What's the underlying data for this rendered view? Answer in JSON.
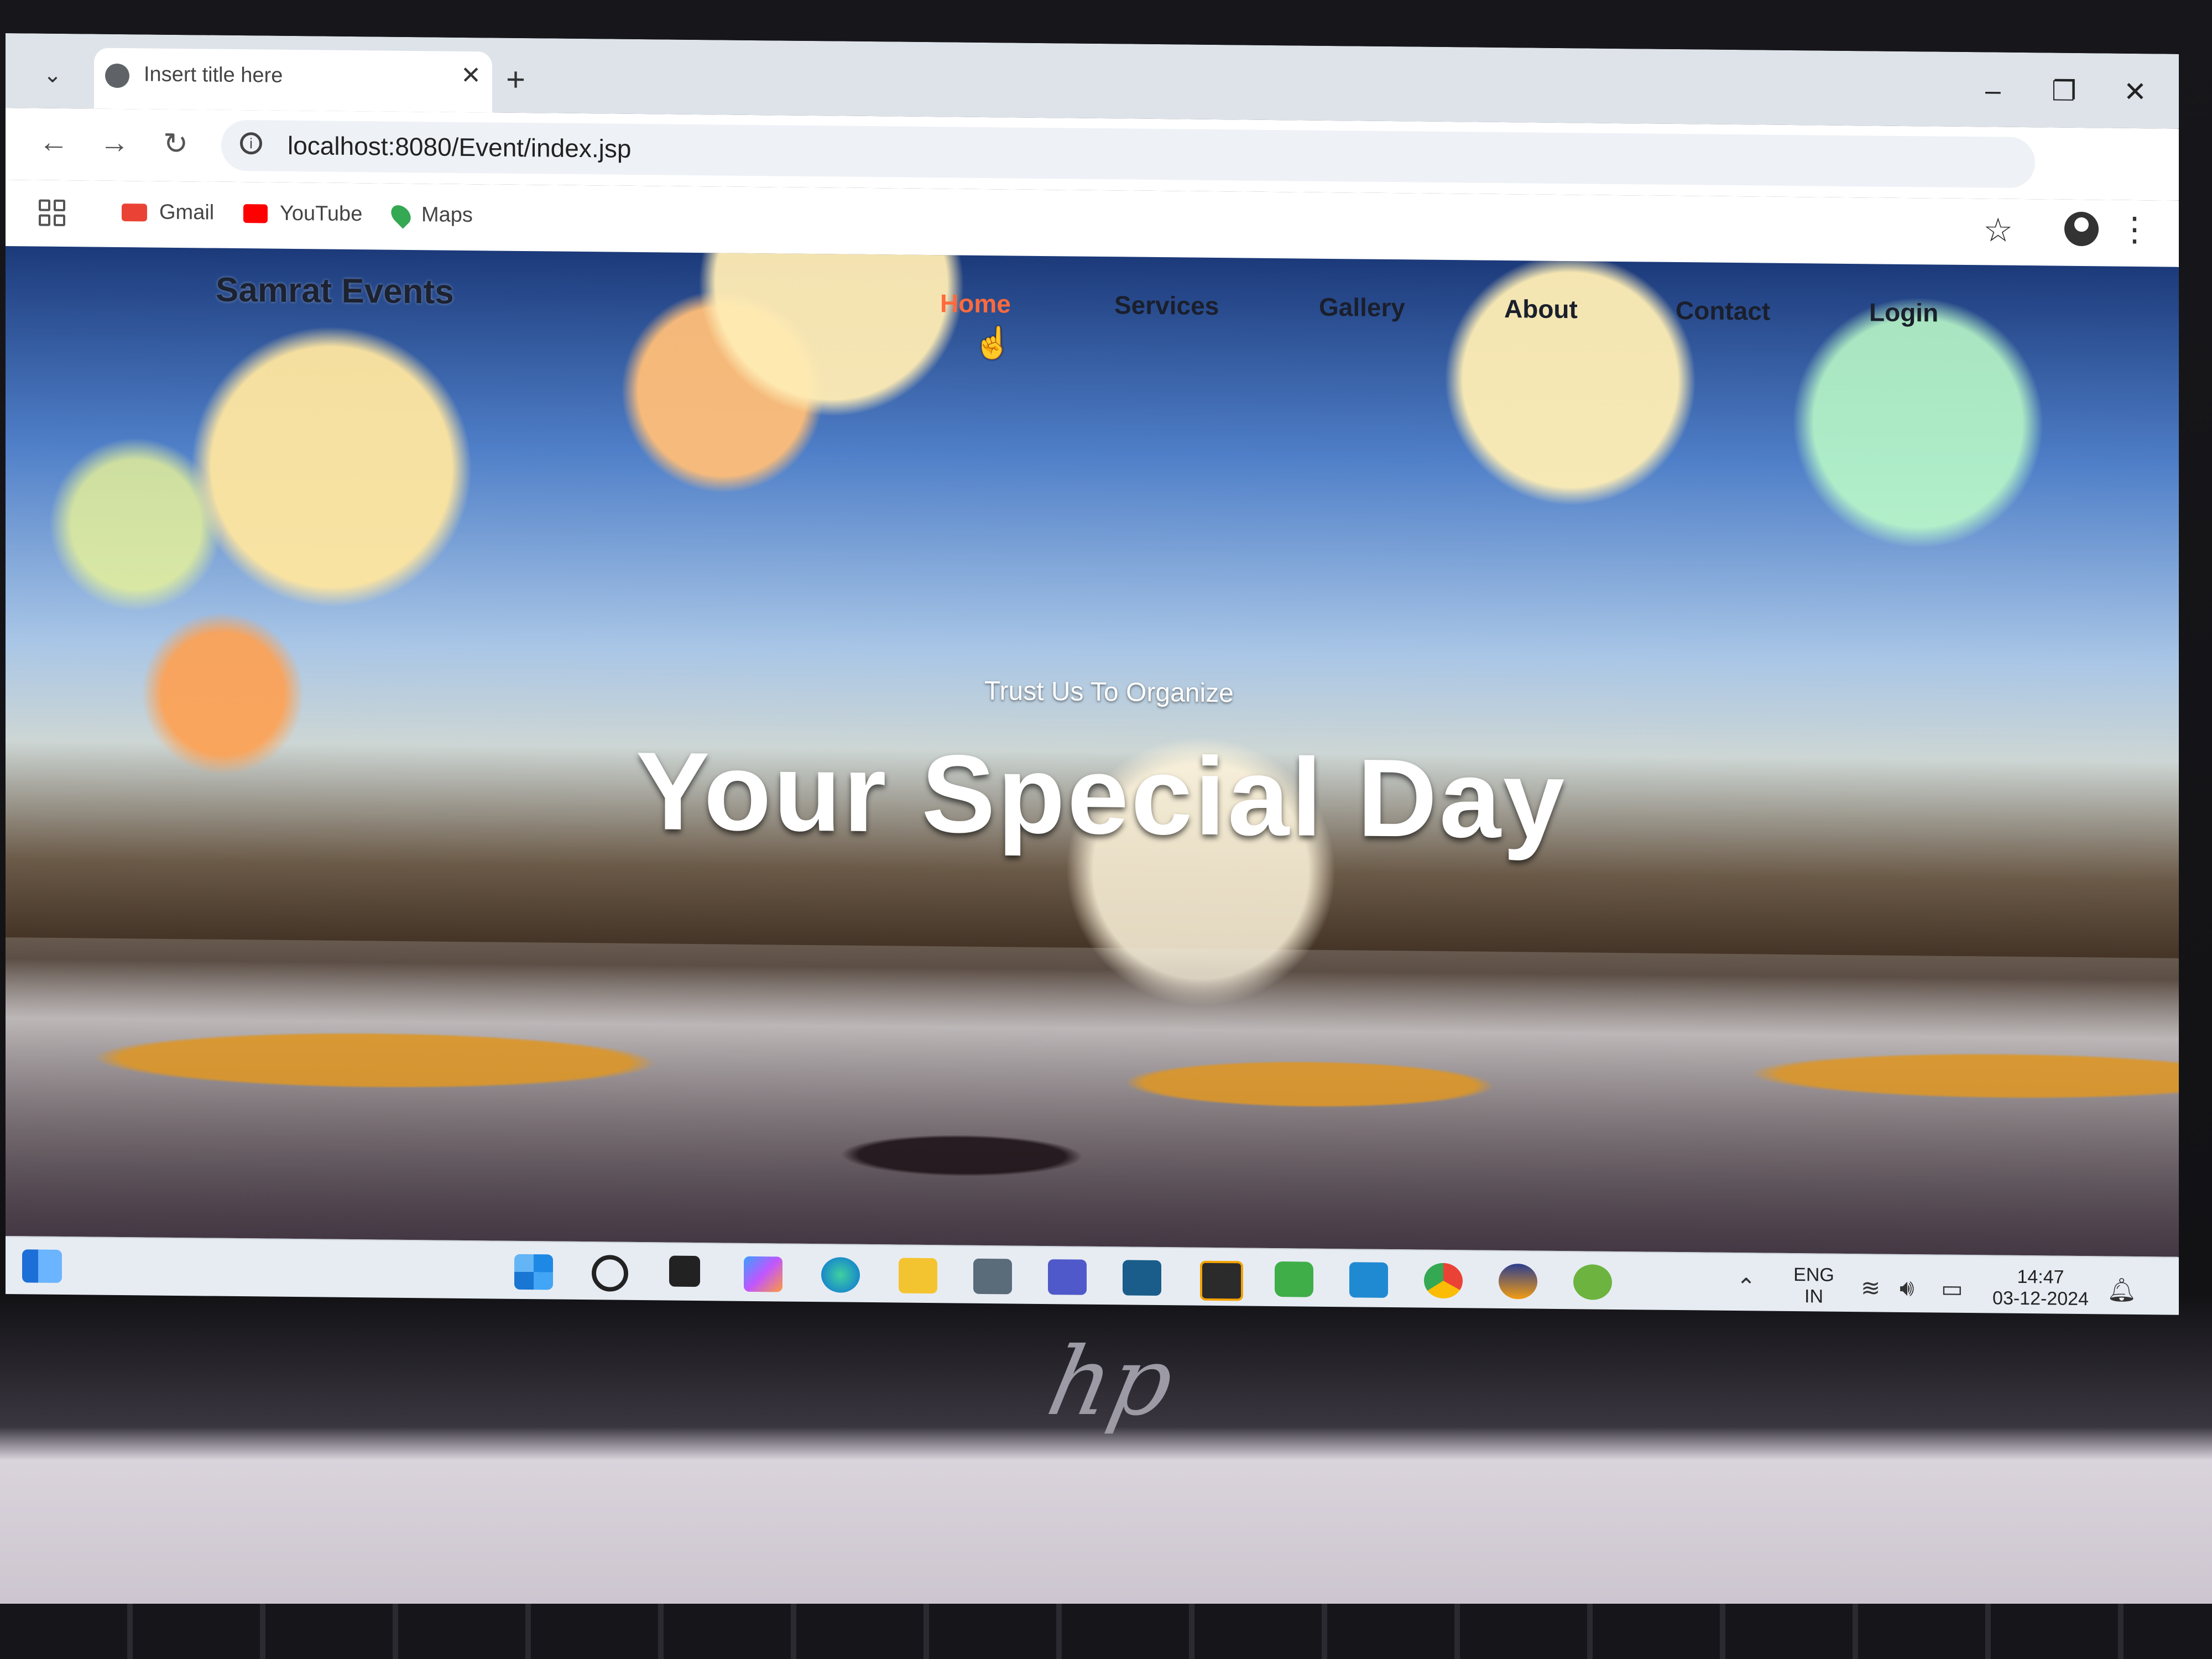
{
  "browser": {
    "tab_title": "Insert title here",
    "new_tab": "+",
    "url": "localhost:8080/Event/index.jsp",
    "bookmarks": [
      "Gmail",
      "YouTube",
      "Maps"
    ],
    "window_controls": [
      "–",
      "❐",
      "✕"
    ]
  },
  "site": {
    "brand": "Samrat Events",
    "nav": [
      "Home",
      "Services",
      "Gallery",
      "About",
      "Contact",
      "Login"
    ],
    "active_nav": "Home",
    "tagline": "Trust Us To Organize",
    "headline": "Your Special Day"
  },
  "taskbar": {
    "language": "ENG",
    "region": "IN",
    "time": "14:47",
    "date": "03-12-2024"
  },
  "device": {
    "logo": "hp"
  },
  "colors": {
    "active_nav": "#ff6a3c",
    "taskbar": "#e7ecf3",
    "chrome_tabbar": "#dee3ea"
  }
}
